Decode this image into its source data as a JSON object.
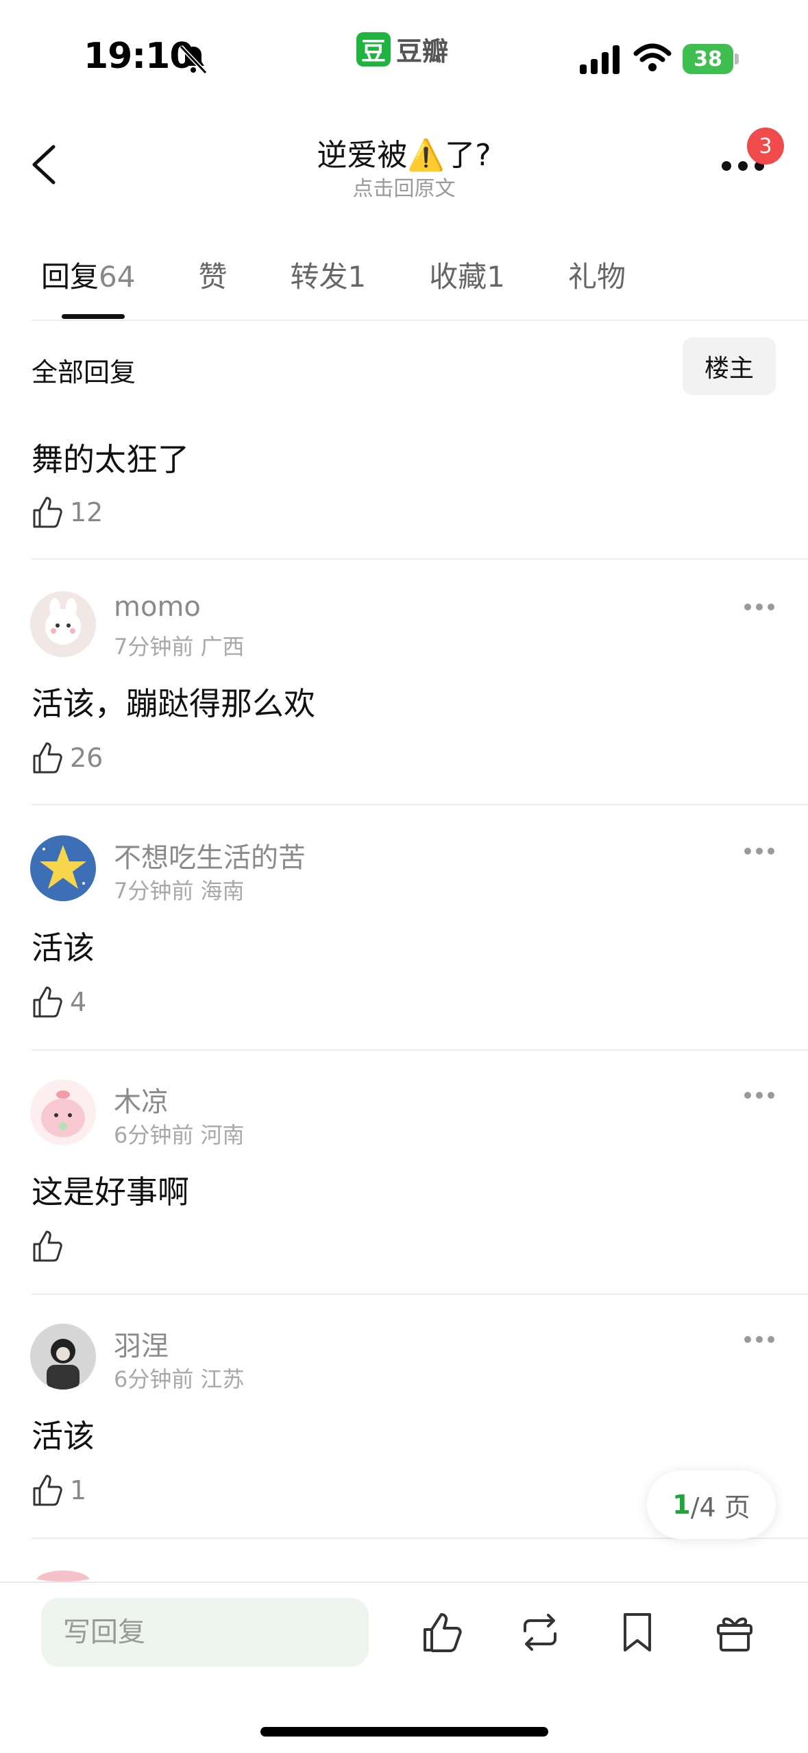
{
  "status_bar": {
    "time": "19:10",
    "battery": "38",
    "app_logo_char": "豆",
    "app_name": "豆瓣"
  },
  "header": {
    "title": "逆爱被⚠️了?",
    "subtitle": "点击回原文",
    "notification_count": "3"
  },
  "tabs": [
    {
      "label": "回复",
      "count": "64",
      "active": true
    },
    {
      "label": "赞",
      "count": "",
      "active": false
    },
    {
      "label": "转发",
      "count": "1",
      "active": false
    },
    {
      "label": "收藏",
      "count": "1",
      "active": false
    },
    {
      "label": "礼物",
      "count": "",
      "active": false
    }
  ],
  "filter": {
    "label": "全部回复",
    "owner_button": "楼主"
  },
  "comments": [
    {
      "text": "舞的太狂了",
      "likes": "12"
    },
    {
      "user": "momo",
      "time": "7分钟前",
      "location": "广西",
      "text": "活该，蹦跶得那么欢",
      "likes": "26"
    },
    {
      "user": "不想吃生活的苦",
      "time": "7分钟前",
      "location": "海南",
      "text": "活该",
      "likes": "4"
    },
    {
      "user": "木凉",
      "time": "6分钟前",
      "location": "河南",
      "text": "这是好事啊",
      "likes": ""
    },
    {
      "user": "羽涅",
      "time": "6分钟前",
      "location": "江苏",
      "text": "活该",
      "likes": "1"
    }
  ],
  "pagination": {
    "current": "1",
    "total_text": "/4 页"
  },
  "bottom_bar": {
    "reply_placeholder": "写回复"
  },
  "colors": {
    "accent_green": "#1fb43f",
    "badge_red": "#f04a4a",
    "input_bg": "#eef5ef"
  }
}
